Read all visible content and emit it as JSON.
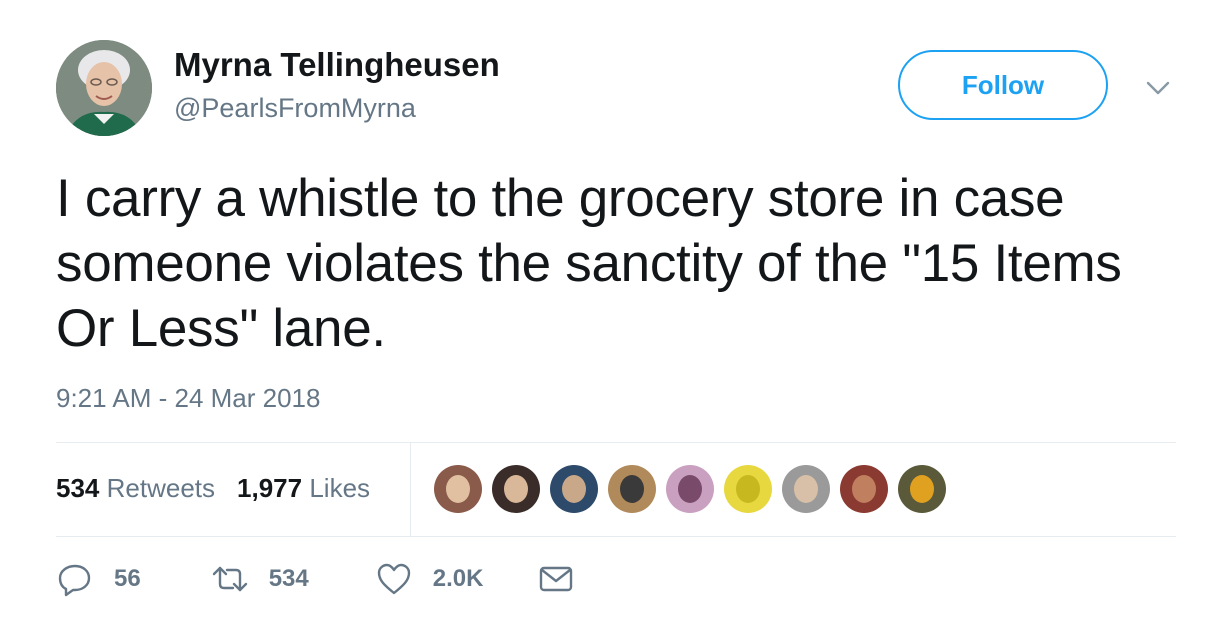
{
  "user": {
    "display_name": "Myrna Tellingheusen",
    "handle": "@PearlsFromMyrna"
  },
  "follow_label": "Follow",
  "tweet": {
    "text": "I carry a whistle to the grocery store in case someone violates the sanctity of the \"15 Items Or Less\" lane.",
    "timestamp": "9:21 AM - 24 Mar 2018"
  },
  "stats": {
    "retweets_count": "534",
    "retweets_label": "Retweets",
    "likes_count": "1,977",
    "likes_label": "Likes"
  },
  "likers": [
    {
      "bg": "#8a5a4a",
      "fg": "#e0c0a0"
    },
    {
      "bg": "#3a2c28",
      "fg": "#d8b898"
    },
    {
      "bg": "#2d4a6a",
      "fg": "#c8a888"
    },
    {
      "bg": "#b08a5a",
      "fg": "#3a3a3a"
    },
    {
      "bg": "#c9a0c0",
      "fg": "#7a4a6a"
    },
    {
      "bg": "#e8d840",
      "fg": "#c8b820"
    },
    {
      "bg": "#9a9a9a",
      "fg": "#d8c0a8"
    },
    {
      "bg": "#8a3a30",
      "fg": "#c08060"
    },
    {
      "bg": "#5a5a3a",
      "fg": "#e0a020"
    }
  ],
  "actions": {
    "replies": "56",
    "retweets": "534",
    "likes": "2.0K"
  },
  "colors": {
    "accent": "#1da1f2",
    "text": "#14171a",
    "muted": "#657786",
    "divider": "#e6ecf0"
  },
  "icons": {
    "reply": "reply-icon",
    "retweet": "retweet-icon",
    "like": "heart-icon",
    "dm": "envelope-icon",
    "caret": "chevron-down-icon"
  }
}
